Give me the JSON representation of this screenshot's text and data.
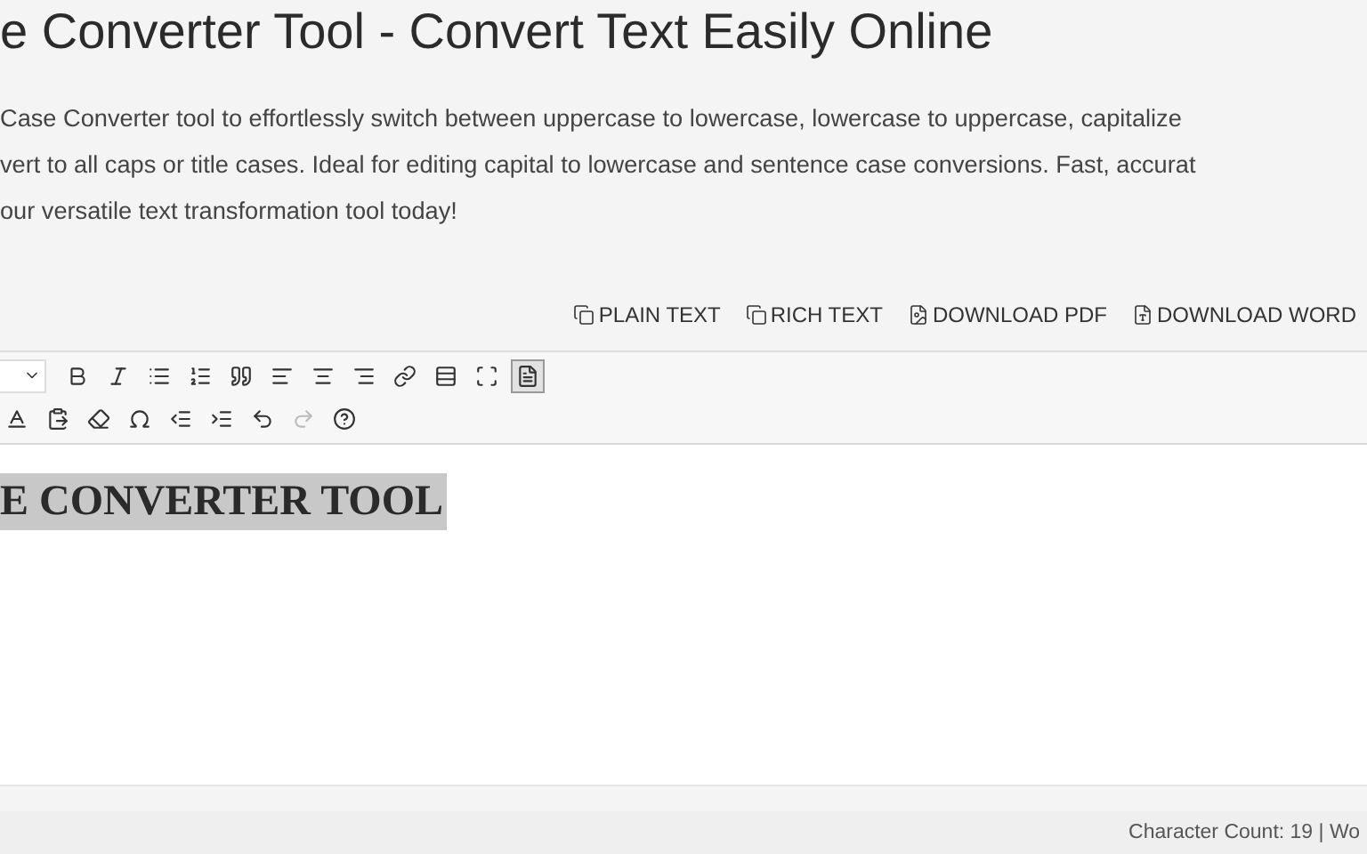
{
  "title": "e Converter Tool - Convert Text Easily Online",
  "description_lines": [
    "Case Converter tool to effortlessly switch between uppercase to lowercase, lowercase to uppercase, capitalize",
    "vert to all caps or title cases. Ideal for editing capital to lowercase and sentence case conversions. Fast, accurat",
    "our versatile text transformation tool today!"
  ],
  "export_actions": [
    {
      "kind": "copy",
      "label": "PLAIN TEXT"
    },
    {
      "kind": "copy",
      "label": "RICH TEXT"
    },
    {
      "kind": "pdf",
      "label": "DOWNLOAD PDF"
    },
    {
      "kind": "word",
      "label": "DOWNLOAD WORD"
    }
  ],
  "toolbar_rows": [
    [
      {
        "kind": "dropdown",
        "on": false
      },
      {
        "kind": "bold",
        "on": false
      },
      {
        "kind": "italic",
        "on": false
      },
      {
        "kind": "bullets",
        "on": false
      },
      {
        "kind": "numbers",
        "on": false
      },
      {
        "kind": "quote",
        "on": false
      },
      {
        "kind": "align-left",
        "on": false
      },
      {
        "kind": "align-center",
        "on": false
      },
      {
        "kind": "align-right",
        "on": false
      },
      {
        "kind": "link",
        "on": false
      },
      {
        "kind": "rule",
        "on": false
      },
      {
        "kind": "fullscreen",
        "on": false
      },
      {
        "kind": "source",
        "on": true
      }
    ],
    [
      {
        "kind": "text-color",
        "disabled": false
      },
      {
        "kind": "paste",
        "disabled": false
      },
      {
        "kind": "eraser",
        "disabled": false
      },
      {
        "kind": "omega",
        "disabled": false
      },
      {
        "kind": "outdent",
        "disabled": false
      },
      {
        "kind": "indent",
        "disabled": false
      },
      {
        "kind": "undo",
        "disabled": false
      },
      {
        "kind": "redo",
        "disabled": true
      },
      {
        "kind": "help",
        "disabled": false
      }
    ]
  ],
  "editor": {
    "heading": "E CONVERTER TOOL",
    "highlighted": true
  },
  "status_bar": "Character Count: 19 | Wo"
}
